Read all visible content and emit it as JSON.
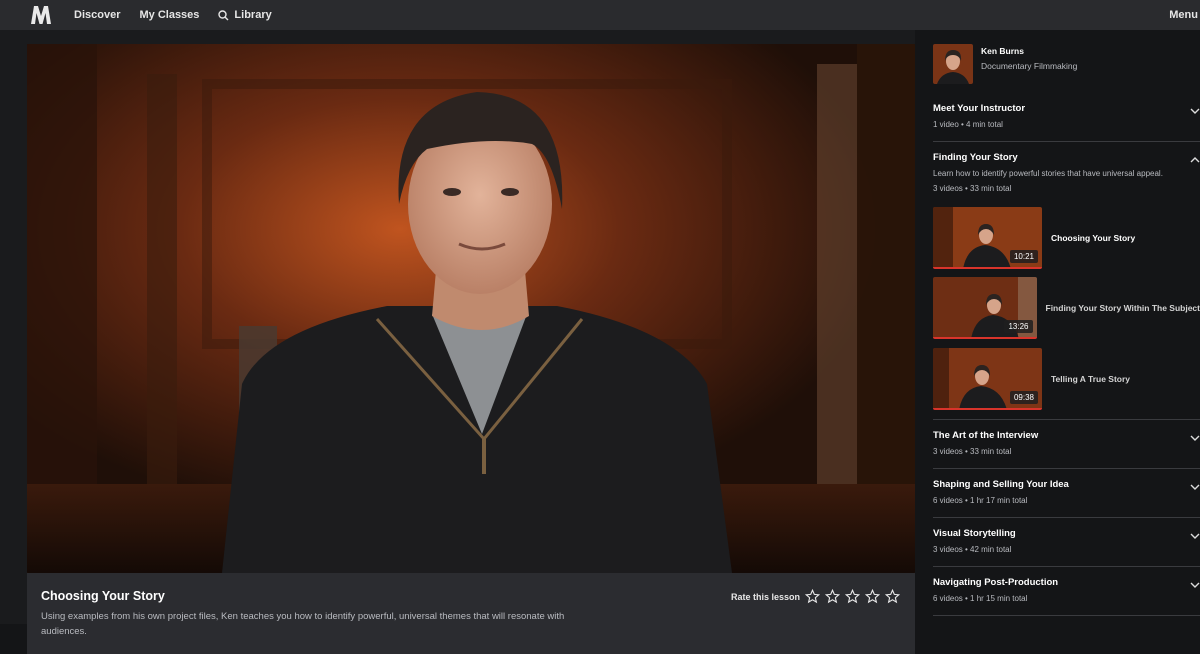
{
  "nav": {
    "logo": "M",
    "discover": "Discover",
    "my_classes": "My Classes",
    "library": "Library",
    "menu": "Menu"
  },
  "lesson": {
    "title": "Choosing Your Story",
    "description": "Using examples from his own project files, Ken teaches you how to identify powerful, universal themes that will resonate with audiences.",
    "rate_label": "Rate this lesson",
    "rating": 0,
    "max_rating": 5
  },
  "instructor": {
    "name": "Ken Burns",
    "course": "Documentary Filmmaking"
  },
  "chapters": [
    {
      "title": "Meet Your Instructor",
      "meta": "1 video • 4 min total"
    },
    {
      "title": "Finding Your Story",
      "description": "Learn how to identify powerful stories that have universal appeal.",
      "meta": "3 videos • 33 min total"
    },
    {
      "title": "The Art of the Interview",
      "meta": "3 videos • 33 min total"
    },
    {
      "title": "Shaping and Selling Your Idea",
      "meta": "6 videos • 1 hr 17 min total"
    },
    {
      "title": "Visual Storytelling",
      "meta": "3 videos • 42 min total"
    },
    {
      "title": "Navigating Post-Production",
      "meta": "6 videos • 1 hr 15 min total"
    }
  ],
  "videos": [
    {
      "title": "Choosing Your Story",
      "duration": "10:21"
    },
    {
      "title": "Finding Your Story Within The Subject",
      "duration": "13:26"
    },
    {
      "title": "Telling A True Story",
      "duration": "09:38"
    }
  ],
  "colors": {
    "accent": "#d9342b",
    "topbar": "#2a2b2e",
    "background": "#141517",
    "panel": "#2b2c30"
  }
}
